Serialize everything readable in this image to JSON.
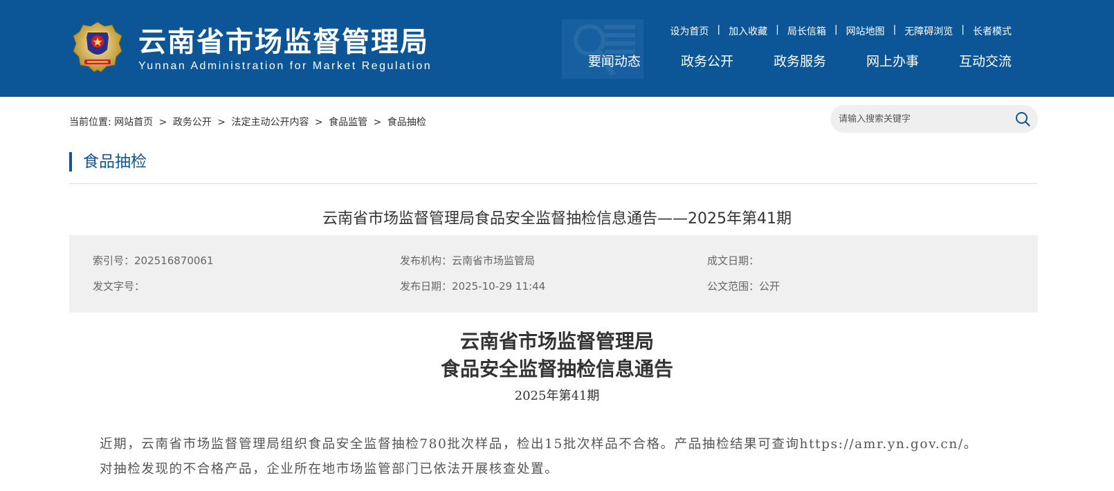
{
  "header": {
    "title": "云南省市场监督管理局",
    "subtitle": "Yunnan Administration for Market Regulation",
    "emblem_icon": "police-emblem-icon",
    "background_color": "#0c5596",
    "top_links": [
      "设为首页",
      "加入收藏",
      "局长信箱",
      "网站地图",
      "无障碍浏览",
      "长者模式"
    ],
    "top_link_separator": "|",
    "nav": [
      "要闻动态",
      "政务公开",
      "政务服务",
      "网上办事",
      "互动交流"
    ]
  },
  "breadcrumb": {
    "prefix": "当前位置:",
    "items": [
      "网站首页",
      "政务公开",
      "法定主动公开内容",
      "食品监管",
      "食品抽检"
    ],
    "separator": ">"
  },
  "search": {
    "placeholder": "请输入搜索关键字",
    "icon": "search-icon"
  },
  "section": {
    "title": "食品抽检",
    "accent_color": "#0c5596"
  },
  "article": {
    "title": "云南省市场监督管理局食品安全监督抽检信息通告——2025年第41期",
    "meta": {
      "index_no": "索引号：202516870061",
      "publisher": "发布机构：云南省市场监管局",
      "written_date": "成文日期：",
      "doc_no": "发文字号：",
      "publish_date": "发布日期：2025-10-29 11:44",
      "scope": "公文范围：公开"
    },
    "doc_org": "云南省市场监督管理局",
    "doc_name": "食品安全监督抽检信息通告",
    "doc_issue": "2025年第41期",
    "body": [
      "近期，云南省市场监督管理局组织食品安全监督抽检780批次样品，检出15批次样品不合格。产品抽检结果可查询https://amr.yn.gov.cn/。",
      "对抽检发现的不合格产品，企业所在地市场监管部门已依法开展核查处置。"
    ]
  }
}
